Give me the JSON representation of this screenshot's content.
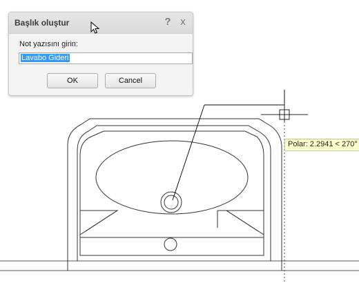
{
  "dialog": {
    "title": "Başlık oluştur",
    "help_glyph": "?",
    "close_glyph": "x",
    "prompt": "Not yazısını girin:",
    "input_value": "Lavabo Gideri",
    "ok_label": "OK",
    "cancel_label": "Cancel"
  },
  "tooltip": {
    "polar_text": "Polar: 2.2941 < 270°"
  },
  "icons": {
    "pointer": "mouse-pointer-icon",
    "crosshair": "crosshair-cursor-icon"
  },
  "colors": {
    "selection": "#3399ff",
    "tooltip_bg": "#ffffcc",
    "drawing_lines": "#333333"
  }
}
